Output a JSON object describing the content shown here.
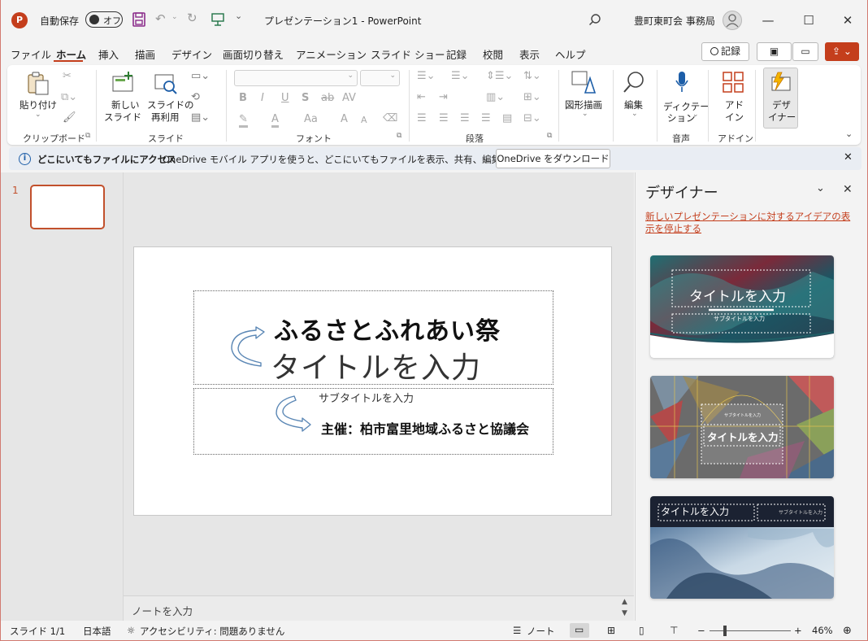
{
  "titlebar": {
    "logo_letter": "P",
    "autosave_label": "自動保存",
    "autosave_state": "オフ",
    "dropdown_glyph": "⌄",
    "doc_title": "プレゼンテーション1  -  PowerPoint",
    "user_name": "豊町東町会 事務局"
  },
  "menu": {
    "tabs": [
      "ファイル",
      "ホーム",
      "挿入",
      "描画",
      "デザイン",
      "画面切り替え",
      "アニメーション",
      "スライド ショー",
      "記録",
      "校閲",
      "表示",
      "ヘルプ"
    ],
    "record_button": "記録"
  },
  "ribbon": {
    "clipboard": {
      "paste_label": "貼り付け",
      "group_label": "クリップボード"
    },
    "slides": {
      "new_slide_line1": "新しい",
      "new_slide_line2": "スライド",
      "reuse_line1": "スライドの",
      "reuse_line2": "再利用",
      "group_label": "スライド"
    },
    "font": {
      "bold": "B",
      "italic": "I",
      "underline": "U",
      "shadow": "S",
      "strike": "ab",
      "spacing": "AV",
      "highlight": "A",
      "fontcolor": "A",
      "case": "Aa",
      "grow": "A",
      "shrink": "A",
      "group_label": "フォント"
    },
    "paragraph": {
      "group_label": "段落"
    },
    "drawing": {
      "label": "図形描画"
    },
    "editing": {
      "label": "編集"
    },
    "voice": {
      "dictate_line1": "ディクテー",
      "dictate_line2": "ション",
      "group_label": "音声"
    },
    "addins": {
      "line1": "アド",
      "line2": "イン",
      "group_label": "アドイン"
    },
    "designer": {
      "line1": "デザ",
      "line2": "イナー"
    }
  },
  "infobar": {
    "bold_text": "どこにいてもファイルにアクセス",
    "text": "OneDrive モバイル アプリを使うと、どこにいてもファイルを表示、共有、編集できます。",
    "button": "OneDrive をダウンロード"
  },
  "thumbnails": {
    "number": "1"
  },
  "slide": {
    "title_overlay": "ふるさとふれあい祭",
    "title_placeholder": "タイトルを入力",
    "subtitle_placeholder": "サブタイトルを入力",
    "subtitle_overlay": "主催：柏市富里地域ふるさと協議会"
  },
  "notes": {
    "placeholder": "ノートを入力"
  },
  "designer": {
    "title": "デザイナー",
    "link": "新しいプレゼンテーションに対するアイデアの表示を停止する",
    "cards": [
      {
        "title": "タイトルを入力",
        "subtitle": "サブタイトルを入力"
      },
      {
        "title": "タイトルを入力",
        "subtitle": "サブタイトルを入力"
      },
      {
        "title": "タイトルを入力",
        "subtitle": "サブタイトルを入力"
      }
    ]
  },
  "statusbar": {
    "slide_count": "スライド 1/1",
    "language": "日本語",
    "accessibility": "アクセシビリティ: 問題ありません",
    "notes_button": "ノート",
    "zoom_minus": "−",
    "zoom_plus": "+",
    "zoom": "46%"
  },
  "colors": {
    "accent": "#c43e1c",
    "info_icon": "#1d5ea8",
    "link": "#c43e1c"
  }
}
